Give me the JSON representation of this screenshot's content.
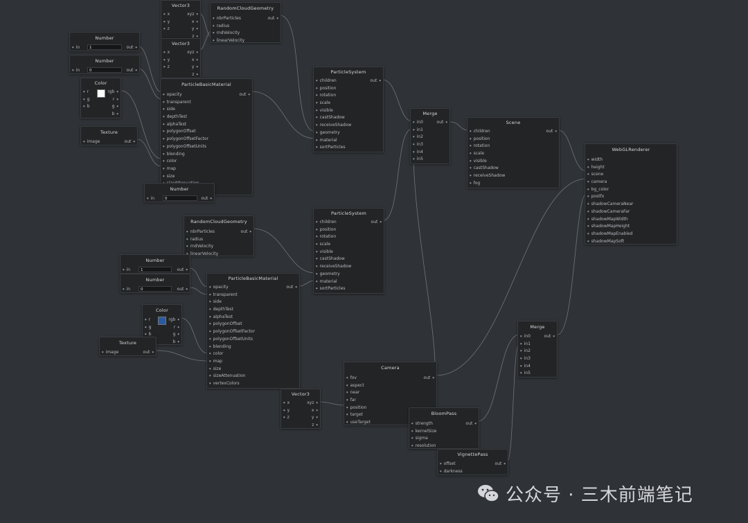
{
  "colors": {
    "background": "#2f3236",
    "node": "#222426",
    "wire": "#7d8186",
    "white_swatch": "#ffffff",
    "blue_swatch": "#2a5aa0"
  },
  "nodes": {
    "vector3_a": {
      "title": "Vector3",
      "inputs": [
        "x",
        "y",
        "z"
      ],
      "outputs": [
        "xyz",
        "x",
        "y",
        "z"
      ]
    },
    "vector3_b": {
      "title": "Vector3",
      "inputs": [
        "x",
        "y",
        "z"
      ],
      "outputs": [
        "xyz",
        "x",
        "y",
        "z"
      ]
    },
    "vector3_c": {
      "title": "Vector3",
      "inputs": [
        "x",
        "y",
        "z"
      ],
      "outputs": [
        "xyz",
        "x",
        "y",
        "z"
      ]
    },
    "rcg_a": {
      "title": "RandomCloudGeometry",
      "inputs": [
        "nbrParticles",
        "radius",
        "rndVelocity",
        "linearVelocity"
      ],
      "output": "out"
    },
    "rcg_b": {
      "title": "RandomCloudGeometry",
      "inputs": [
        "nbrParticles",
        "radius",
        "rndVelocity",
        "linearVelocity"
      ],
      "output": "out"
    },
    "number_a": {
      "title": "Number",
      "input": "in",
      "value": "1",
      "output": "out"
    },
    "number_b": {
      "title": "Number",
      "input": "in",
      "value": "0",
      "output": "out"
    },
    "number_c": {
      "title": "Number",
      "input": "in",
      "value": "0",
      "output": "out"
    },
    "number_d": {
      "title": "Number",
      "input": "in",
      "value": "1",
      "output": "out"
    },
    "number_e": {
      "title": "Number",
      "input": "in",
      "value": "0",
      "output": "out"
    },
    "color_a": {
      "title": "Color",
      "inputs": [
        "r",
        "g",
        "b"
      ],
      "outputs": [
        "rgb",
        "r",
        "g",
        "b"
      ]
    },
    "color_b": {
      "title": "Color",
      "inputs": [
        "r",
        "g",
        "b"
      ],
      "outputs": [
        "rgb",
        "r",
        "g",
        "b"
      ]
    },
    "texture_a": {
      "title": "Texture",
      "input": "image",
      "output": "out"
    },
    "texture_b": {
      "title": "Texture",
      "input": "image",
      "output": "out"
    },
    "pbm_a": {
      "title": "ParticleBasicMaterial",
      "output": "out",
      "inputs": [
        "opacity",
        "transparent",
        "side",
        "depthTest",
        "alphaTest",
        "polygonOffset",
        "polygonOffsetFactor",
        "polygonOffsetUnits",
        "blending",
        "color",
        "map",
        "size",
        "sizeAttenuation"
      ]
    },
    "pbm_b": {
      "title": "ParticleBasicMaterial",
      "output": "out",
      "inputs": [
        "opacity",
        "transparent",
        "side",
        "depthTest",
        "alphaTest",
        "polygonOffset",
        "polygonOffsetFactor",
        "polygonOffsetUnits",
        "blending",
        "color",
        "map",
        "size",
        "sizeAttenuation",
        "vertexColors"
      ]
    },
    "ps_a": {
      "title": "ParticleSystem",
      "output": "out",
      "inputs": [
        "children",
        "position",
        "rotation",
        "scale",
        "visible",
        "castShadow",
        "receiveShadow",
        "geometry",
        "material",
        "sortParticles"
      ]
    },
    "ps_b": {
      "title": "ParticleSystem",
      "output": "out",
      "inputs": [
        "children",
        "position",
        "rotation",
        "scale",
        "visible",
        "castShadow",
        "receiveShadow",
        "geometry",
        "material",
        "sortParticles"
      ]
    },
    "merge_a": {
      "title": "Merge",
      "inputs": [
        "in0",
        "in1",
        "in2",
        "in3",
        "in4",
        "in5"
      ],
      "output": "out"
    },
    "merge_b": {
      "title": "Merge",
      "inputs": [
        "in0",
        "in1",
        "in2",
        "in3",
        "in4",
        "in5"
      ],
      "output": "out"
    },
    "scene": {
      "title": "Scene",
      "output": "out",
      "inputs": [
        "children",
        "position",
        "rotation",
        "scale",
        "visible",
        "castShadow",
        "receiveShadow",
        "fog"
      ]
    },
    "renderer": {
      "title": "WebGLRenderer",
      "inputs": [
        "width",
        "height",
        "scene",
        "camera",
        "bg_color",
        "postfx",
        "shadowCameraNear",
        "shadowCameraFar",
        "shadowMapWidth",
        "shadowMapHeight",
        "shadowMapEnabled",
        "shadowMapSoft"
      ]
    },
    "camera": {
      "title": "Camera",
      "output": "out",
      "inputs": [
        "fov",
        "aspect",
        "near",
        "far",
        "position",
        "target",
        "useTarget"
      ]
    },
    "bloom": {
      "title": "BloomPass",
      "output": "out",
      "inputs": [
        "strength",
        "kernelSize",
        "sigma",
        "resolution"
      ]
    },
    "vignette": {
      "title": "VignettePass",
      "output": "out",
      "inputs": [
        "offset",
        "darkness"
      ]
    }
  },
  "watermark": {
    "text": "公众号 · 三木前端笔记",
    "icon": "wechat-icon"
  }
}
